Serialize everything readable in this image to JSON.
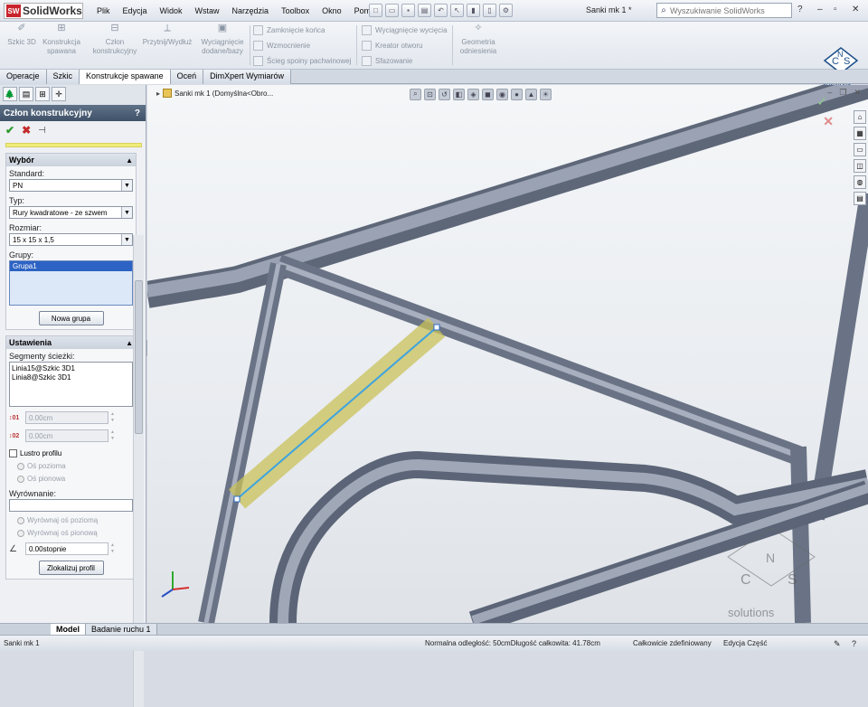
{
  "app": {
    "logo_text": "SolidWorks",
    "logo_mark": "SW",
    "doc_title": "Sanki mk 1 *"
  },
  "menu": [
    "Plik",
    "Edycja",
    "Widok",
    "Wstaw",
    "Narzędzia",
    "Toolbox",
    "Okno",
    "Pomoc"
  ],
  "search": {
    "placeholder": "Wyszukiwanie SolidWorks"
  },
  "ribbon": {
    "szkic3d": "Szkic 3D",
    "konstrukcja_spawana": "Konstrukcja spawana",
    "czlon": "Człon konstrukcyjny",
    "przytnij": "Przytnij/Wydłuż",
    "wyciagniecie": "Wyciągnięcie dodane/bazy",
    "zamkniecie": "Zamknięcie końca",
    "wzmocnienie": "Wzmocnienie",
    "scieg": "Ścieg spoiny pachwinowej",
    "wyciecie": "Wyciągnięcie wycięcia",
    "kreator": "Kreator otworu",
    "sfazowanie": "Sfazowanie",
    "geometria": "Geometria odniesienia"
  },
  "cns_logo": {
    "c": "C",
    "n": "N",
    "s": "S",
    "tag": "solutions"
  },
  "tabs": [
    "Operacje",
    "Szkic",
    "Konstrukcje spawane",
    "Oceń",
    "DimXpert Wymiarów"
  ],
  "panel": {
    "title": "Człon konstrukcyjny",
    "wybor": {
      "head": "Wybór",
      "standard_label": "Standard:",
      "standard_value": "PN",
      "typ_label": "Typ:",
      "typ_value": "Rury kwadratowe - ze szwem",
      "rozmiar_label": "Rozmiar:",
      "rozmiar_value": "15 x 15 x 1,5",
      "grupy_label": "Grupy:",
      "grupa_item": "Grupa1",
      "nowa_grupa": "Nowa grupa"
    },
    "ustawienia": {
      "head": "Ustawienia",
      "segmenty_label": "Segmenty ścieżki:",
      "segmenty": [
        "Linia15@Szkic 3D1",
        "Linia8@Szkic 3D1"
      ],
      "offset1": "0.00cm",
      "offset2": "0.00cm",
      "lustro": "Lustro profilu",
      "os_pozioma": "Oś pozioma",
      "os_pionowa": "Oś pionowa",
      "wyrownanie_label": "Wyrównanie:",
      "wyrownaj_poziome": "Wyrównaj oś poziomą",
      "wyrownaj_pionowa": "Wyrównaj oś pionową",
      "kat": "0.00stopnie",
      "zlokalizuj": "Zlokalizuj profil"
    }
  },
  "viewport": {
    "crumb": "Sanki mk 1  (Domyślna<Obro..."
  },
  "bottom_tabs": [
    "Model",
    "Badanie ruchu 1"
  ],
  "status": {
    "left": "Sanki mk 1",
    "measure": "Normalna odległość: 50cmDługość całkowita: 41.78cm",
    "defined": "Całkowicie zdefiniowany",
    "edit": "Edycja Część"
  },
  "watermark": {
    "c": "C",
    "n": "N",
    "s": "S",
    "tag": "solutions"
  }
}
